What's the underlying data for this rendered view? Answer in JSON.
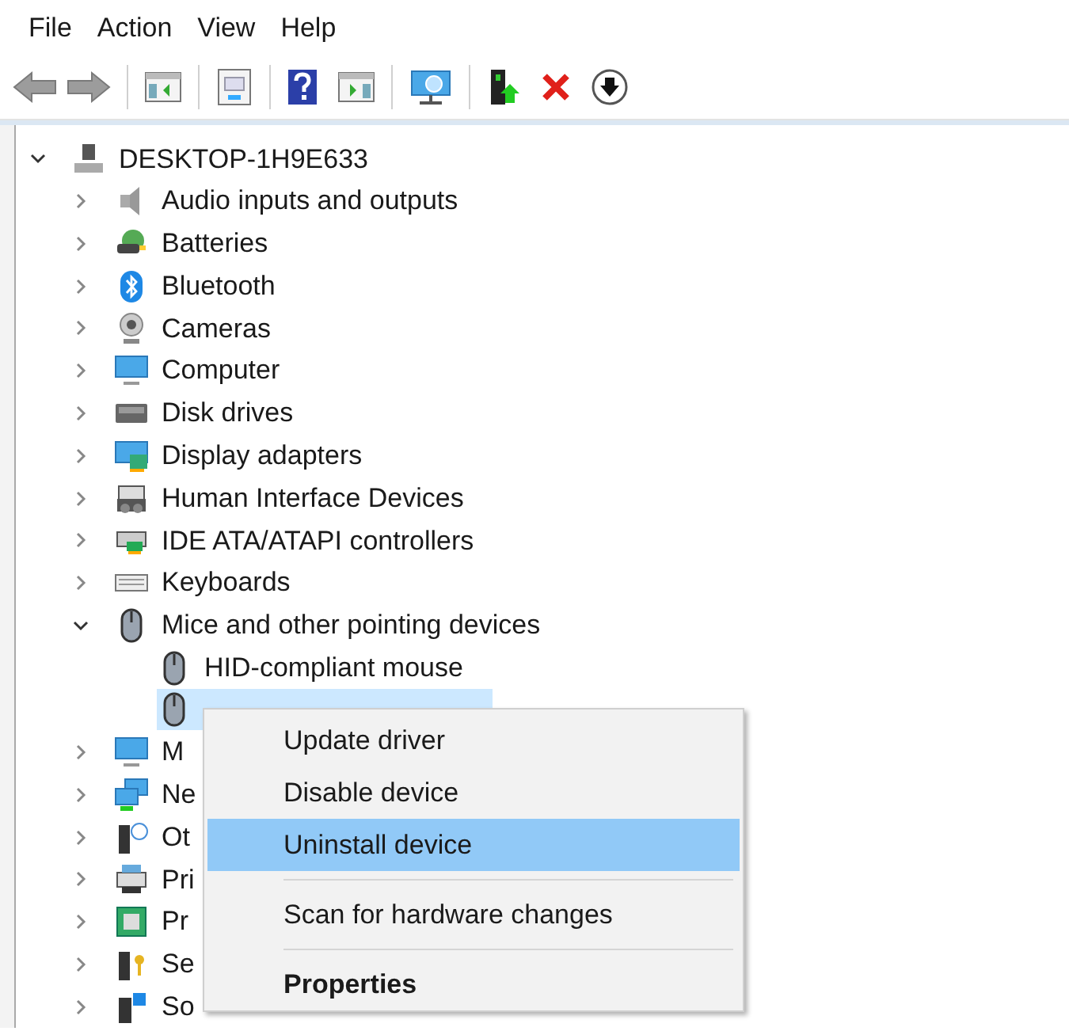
{
  "menu_bar": [
    "File",
    "Action",
    "View",
    "Help"
  ],
  "tree": {
    "label": "DESKTOP-1H9E633",
    "expanded": true,
    "selected": false,
    "children": [
      {
        "label": "Audio inputs and outputs",
        "expanded": false,
        "selected": false
      },
      {
        "label": "Batteries",
        "expanded": false,
        "selected": false
      },
      {
        "label": "Bluetooth",
        "expanded": false,
        "selected": false
      },
      {
        "label": "Cameras",
        "expanded": false,
        "selected": false
      },
      {
        "label": "Computer",
        "expanded": false,
        "selected": false
      },
      {
        "label": "Disk drives",
        "expanded": false,
        "selected": false
      },
      {
        "label": "Display adapters",
        "expanded": false,
        "selected": false
      },
      {
        "label": "Human Interface Devices",
        "expanded": false,
        "selected": false
      },
      {
        "label": "IDE ATA/ATAPI controllers",
        "expanded": false,
        "selected": false
      },
      {
        "label": "Keyboards",
        "expanded": false,
        "selected": false
      },
      {
        "label": "Mice and other pointing devices",
        "expanded": true,
        "selected": false,
        "children": [
          {
            "label": "HID-compliant mouse",
            "selected": false
          },
          {
            "selected": true
          }
        ]
      },
      {
        "label": "M",
        "expanded": false,
        "selected": false
      },
      {
        "label": "Ne",
        "expanded": false,
        "selected": false
      },
      {
        "label": "Ot",
        "expanded": false,
        "selected": false
      },
      {
        "label": "Pri",
        "expanded": false,
        "selected": false
      },
      {
        "label": "Pr",
        "expanded": false,
        "selected": false
      },
      {
        "label": "Se",
        "expanded": false,
        "selected": false
      },
      {
        "label": "So",
        "expanded": false,
        "selected": false
      }
    ]
  },
  "context_menu": {
    "items": [
      {
        "kind": "item",
        "label": "Update driver",
        "highlighted": false,
        "default": false
      },
      {
        "kind": "item",
        "label": "Disable device",
        "highlighted": false,
        "default": false
      },
      {
        "kind": "item",
        "label": "Uninstall device",
        "highlighted": true,
        "default": false
      },
      {
        "kind": "separator"
      },
      {
        "kind": "item",
        "label": "Scan for hardware changes",
        "highlighted": false,
        "default": false
      },
      {
        "kind": "separator"
      },
      {
        "kind": "item",
        "label": "Properties",
        "highlighted": false,
        "default": true
      }
    ]
  }
}
